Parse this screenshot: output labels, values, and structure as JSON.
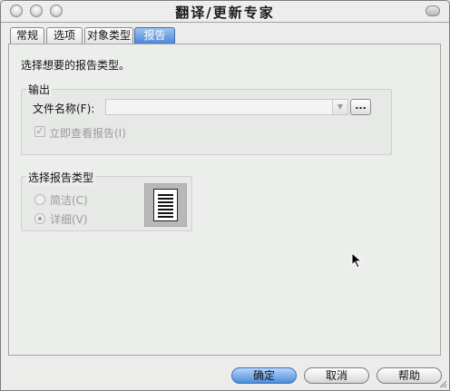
{
  "window": {
    "title": "翻译/更新专家"
  },
  "tabs": [
    {
      "label": "常规",
      "active": false
    },
    {
      "label": "选项",
      "active": false
    },
    {
      "label": "对象类型",
      "active": false
    },
    {
      "label": "报告",
      "active": true
    }
  ],
  "panel": {
    "intro_text": "选择想要的报告类型。",
    "output_group": {
      "title": "输出",
      "filename_label": "文件名称(F):",
      "filename_value": "",
      "browse_label": "...",
      "view_report_checkbox_label": "立即查看报告(I)",
      "view_report_checked": true,
      "enabled": false
    },
    "report_type_group": {
      "title": "选择报告类型",
      "options": [
        {
          "label": "简洁(C)",
          "selected": false
        },
        {
          "label": "详细(V)",
          "selected": true
        }
      ],
      "preview_icon": "document-lines-icon"
    }
  },
  "buttons": {
    "ok": "确定",
    "cancel": "取消",
    "help": "帮助"
  },
  "icons": {
    "close": "close-circle-icon",
    "minimize": "minimize-circle-icon",
    "zoom": "zoom-circle-icon",
    "toolbar_toggle": "toolbar-toggle-pill-icon",
    "combo_arrow": "dropdown-arrow-icon",
    "cursor": "mouse-pointer-icon",
    "resize": "resize-grip-icon"
  },
  "colors": {
    "accent": "#4a86d8",
    "window_bg": "#ececea",
    "disabled_text": "#9a9a9a"
  }
}
